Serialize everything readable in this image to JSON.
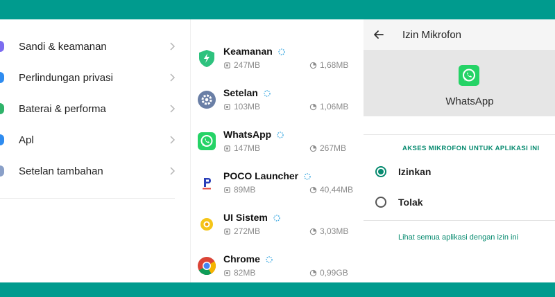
{
  "left_menu": {
    "items": [
      {
        "label": "Sandi & keamanan",
        "color": "#7c6cf0"
      },
      {
        "label": "Perlindungan privasi",
        "color": "#2f8cf0"
      },
      {
        "label": "Baterai & performa",
        "color": "#2fb36a"
      },
      {
        "label": "Apl",
        "color": "#2f8cf0"
      },
      {
        "label": "Setelan tambahan",
        "color": "#8aa0c8"
      }
    ]
  },
  "apps": {
    "rows": [
      {
        "name": "Keamanan",
        "memory": "247MB",
        "storage": "1,68MB",
        "icon": "shield-icon",
        "color": "#2ec27e"
      },
      {
        "name": "Setelan",
        "memory": "103MB",
        "storage": "1,06MB",
        "icon": "gear-icon",
        "color": "#6a7fa6"
      },
      {
        "name": "WhatsApp",
        "memory": "147MB",
        "storage": "267MB",
        "icon": "whatsapp-icon",
        "color": "#25d366"
      },
      {
        "name": "POCO Launcher",
        "memory": "89MB",
        "storage": "40,44MB",
        "icon": "poco-launcher-icon",
        "color": "#2a3fb8"
      },
      {
        "name": "UI Sistem",
        "memory": "272MB",
        "storage": "3,03MB",
        "icon": "system-ui-icon",
        "color": "#f5c518"
      },
      {
        "name": "Chrome",
        "memory": "82MB",
        "storage": "0,99GB",
        "icon": "chrome-icon",
        "color": "#db4437"
      }
    ]
  },
  "permission": {
    "title": "Izin Mikrofon",
    "app_name": "WhatsApp",
    "section_header": "AKSES MIKROFON UNTUK APLIKASI INI",
    "options": [
      {
        "label": "Izinkan",
        "selected": true
      },
      {
        "label": "Tolak",
        "selected": false
      }
    ],
    "link": "Lihat semua aplikasi dengan izin ini",
    "accent": "#068a6f"
  },
  "frame_color": "#009b8e"
}
